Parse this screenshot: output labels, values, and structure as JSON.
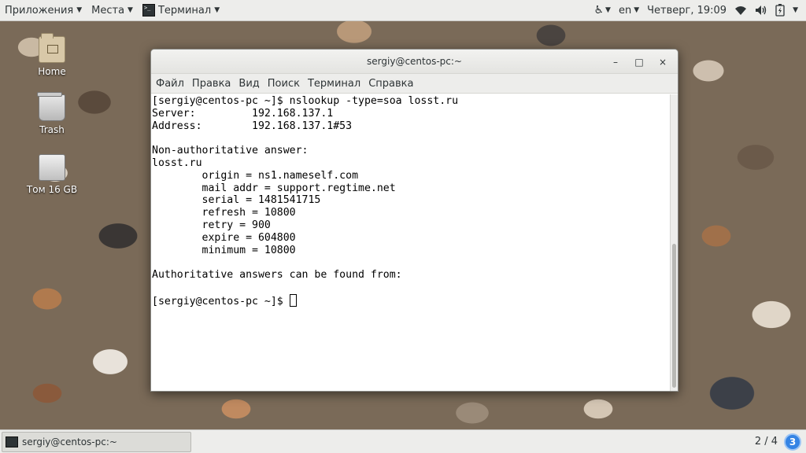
{
  "topbar": {
    "applications": "Приложения",
    "places": "Места",
    "active_app": "Терминал",
    "accessibility_icon": "accessibility-icon",
    "language": "en",
    "datetime": "Четверг, 19:09",
    "wifi_icon": "wifi-icon",
    "volume_icon": "volume-icon",
    "battery_icon": "battery-icon"
  },
  "desktop": {
    "icons": [
      {
        "label": "Home",
        "icon": "home-folder-icon"
      },
      {
        "label": "Trash",
        "icon": "trash-icon"
      },
      {
        "label": "Том 16 GB",
        "icon": "drive-icon"
      }
    ]
  },
  "window": {
    "title": "sergiy@centos-pc:~",
    "buttons": {
      "minimize": "–",
      "maximize": "□",
      "close": "×"
    },
    "menu": [
      "Файл",
      "Правка",
      "Вид",
      "Поиск",
      "Терминал",
      "Справка"
    ]
  },
  "terminal": {
    "lines": [
      "[sergiy@centos-pc ~]$ nslookup -type=soa losst.ru",
      "Server:         192.168.137.1",
      "Address:        192.168.137.1#53",
      "",
      "Non-authoritative answer:",
      "losst.ru",
      "        origin = ns1.nameself.com",
      "        mail addr = support.regtime.net",
      "        serial = 1481541715",
      "        refresh = 10800",
      "        retry = 900",
      "        expire = 604800",
      "        minimum = 10800",
      "",
      "Authoritative answers can be found from:",
      ""
    ],
    "prompt": "[sergiy@centos-pc ~]$ "
  },
  "taskbar": {
    "task_label": "sergiy@centos-pc:~",
    "workspace": "2 / 4",
    "notifications": "3"
  }
}
